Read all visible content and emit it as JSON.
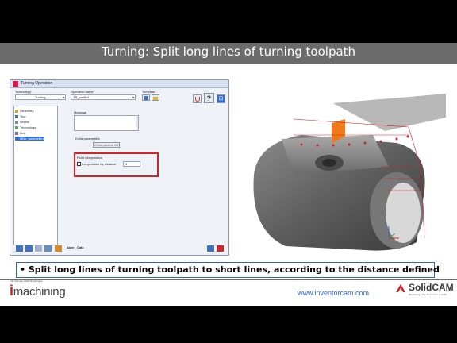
{
  "slide": {
    "title": "Turning: Split long lines of turning toolpath",
    "caption": "• Split long lines of turning toolpath to short lines, according to the distance defined",
    "url": "www.inventorcam.com",
    "logo_left": "machining",
    "logo_left_tagline": "The Ultimate Machining Engine",
    "logo_right": "SolidCAM",
    "logo_right_tagline": "iMachining · The Revolution in CAM"
  },
  "dialog": {
    "title": "Turning Operation",
    "technology_label": "Technology",
    "technology_value": "Turning",
    "operation_name_label": "Operation name",
    "operation_name_value": "TR_profile1",
    "template_label": "Template",
    "tree": [
      {
        "label": "Geometry",
        "color": "#c9a23a"
      },
      {
        "label": "Tool",
        "color": "#3f73b9"
      },
      {
        "label": "Levels",
        "color": "#7a8a9c"
      },
      {
        "label": "Technology",
        "color": "#5aa048"
      },
      {
        "label": "Link",
        "color": "#6a6a9a"
      },
      {
        "label": "Misc. parameters",
        "color": "#2f6fd3"
      }
    ],
    "message_label": "Message",
    "extra_params_label": "Extra parameters",
    "extra_params_button": "Extra params list",
    "point_interp_label": "Point interpolation",
    "point_interp_check": "Interpolation by distance",
    "point_interp_value": "1",
    "toolbar_labels": {
      "save": "Save",
      "calc": "Calc"
    },
    "bottom_toolbar": [
      "💾",
      "💾",
      "✎",
      "▦",
      "▩"
    ]
  },
  "colors": {
    "accent_red": "#d3242b",
    "title_bar": "#6b6b6b",
    "url_blue": "#3168c4",
    "caption_border": "#2d66c4"
  }
}
